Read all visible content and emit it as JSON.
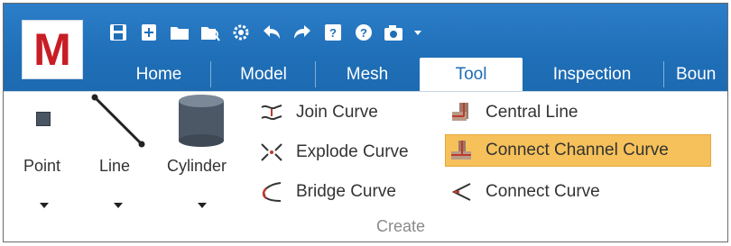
{
  "logo": {
    "letter": "M"
  },
  "quick_access": [
    {
      "name": "save-icon"
    },
    {
      "name": "new-icon"
    },
    {
      "name": "open-folder-icon"
    },
    {
      "name": "search-file-icon"
    },
    {
      "name": "settings-gear-icon"
    },
    {
      "name": "undo-icon"
    },
    {
      "name": "redo-icon"
    },
    {
      "name": "help-book-icon"
    },
    {
      "name": "help-circle-icon"
    },
    {
      "name": "camera-icon"
    },
    {
      "name": "qat-dropdown-icon"
    }
  ],
  "tabs": [
    {
      "label": "Home"
    },
    {
      "label": "Model"
    },
    {
      "label": "Mesh"
    },
    {
      "label": "Tool",
      "active": true
    },
    {
      "label": "Inspection"
    },
    {
      "label": "Boun"
    }
  ],
  "ribbon": {
    "point_label": "Point",
    "line_label": "Line",
    "cylinder_label": "Cylinder",
    "join_curve": "Join Curve",
    "explode_curve": "Explode Curve",
    "bridge_curve": "Bridge Curve",
    "central_line": "Central Line",
    "connect_channel_curve": "Connect Channel Curve",
    "connect_curve": "Connect Curve",
    "group_label": "Create"
  },
  "colors": {
    "title_blue": "#1f6fb8",
    "active_tab_text": "#1e6db5",
    "highlight": "#f6c15a",
    "logo_red": "#c81d25"
  }
}
